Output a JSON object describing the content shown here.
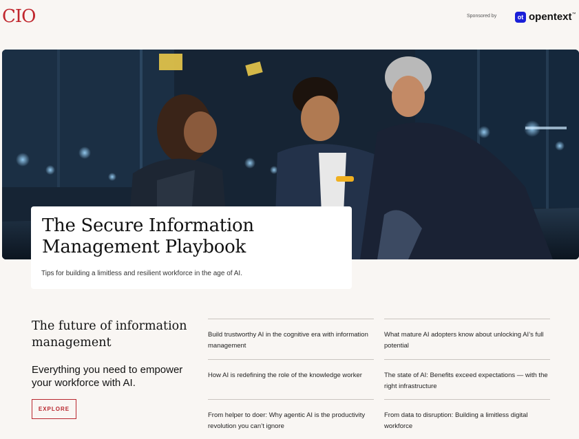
{
  "header": {
    "brand": "CIO",
    "sponsored_label": "Sponsored by",
    "sponsor_mark": "ot",
    "sponsor_name": "opentext",
    "sponsor_tm": "™"
  },
  "hero": {
    "image_icon": "team-meeting-photo"
  },
  "title_card": {
    "title": "The Secure Information Management Playbook",
    "subtitle": "Tips for building a limitless and resilient workforce in the age of AI."
  },
  "section": {
    "heading": "The future of information management",
    "lead": "Everything you need to empower your workforce with AI.",
    "explore_label": "EXPLORE"
  },
  "articles": [
    "Build trustworthy AI in the cognitive era with information management",
    "What mature AI adopters know about unlocking AI’s full potential",
    "How AI is redefining the role of the knowledge worker",
    "The state of AI: Benefits exceed expectations — with the right infrastructure",
    "From helper to doer: Why agentic AI is the productivity revolution you can’t ignore",
    "From data to disruption: Building a limitless digital workforce"
  ],
  "colors": {
    "brand_red": "#c0262d",
    "background": "#f9f6f3",
    "sponsor_blue": "#1a1fd8"
  }
}
